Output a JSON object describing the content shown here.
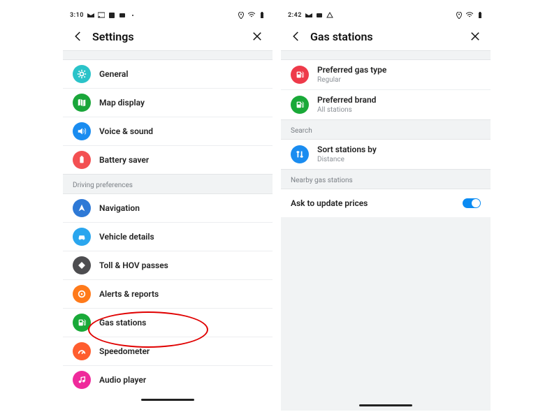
{
  "left": {
    "status": {
      "time": "3:10",
      "left_icons": [
        "gmail",
        "cast",
        "app",
        "square",
        "dot"
      ],
      "right_icons": [
        "pin",
        "wifi",
        "battery"
      ]
    },
    "appbar": {
      "title": "Settings"
    },
    "top_items": [
      {
        "label": "General",
        "icon": "gear",
        "color": "#2ac3c9"
      },
      {
        "label": "Map display",
        "icon": "map",
        "color": "#1aa63a"
      },
      {
        "label": "Voice & sound",
        "icon": "speaker",
        "color": "#1a8cf0"
      },
      {
        "label": "Battery saver",
        "icon": "battery",
        "color": "#f35052"
      }
    ],
    "driving_label": "Driving preferences",
    "driving_items": [
      {
        "label": "Navigation",
        "icon": "nav",
        "color": "#2e79d6"
      },
      {
        "label": "Vehicle details",
        "icon": "car",
        "color": "#2aa6ee"
      },
      {
        "label": "Toll & HOV passes",
        "icon": "diamond",
        "color": "#4d4d50"
      },
      {
        "label": "Alerts & reports",
        "icon": "target",
        "color": "#ff7a1a"
      },
      {
        "label": "Gas stations",
        "icon": "pump",
        "color": "#19a938"
      },
      {
        "label": "Speedometer",
        "icon": "speed",
        "color": "#ff5d2e"
      },
      {
        "label": "Audio player",
        "icon": "music",
        "color": "#ef2a9b"
      }
    ]
  },
  "right": {
    "status": {
      "time": "2:42",
      "left_icons": [
        "gmail",
        "square",
        "warn"
      ],
      "right_icons": [
        "pin",
        "wifi",
        "battery"
      ]
    },
    "appbar": {
      "title": "Gas stations"
    },
    "pref_items": [
      {
        "label": "Preferred gas type",
        "sub": "Regular",
        "icon": "pump",
        "color": "#ee3a4a"
      },
      {
        "label": "Preferred brand",
        "sub": "All stations",
        "icon": "pump",
        "color": "#19a938"
      }
    ],
    "search_label": "Search",
    "search_items": [
      {
        "label": "Sort stations by",
        "sub": "Distance",
        "icon": "sort",
        "color": "#1a8cf0"
      }
    ],
    "nearby_label": "Nearby gas stations",
    "toggle_row": {
      "label": "Ask to update prices",
      "on": true
    }
  },
  "annotation": {
    "target_label": "Gas stations"
  }
}
